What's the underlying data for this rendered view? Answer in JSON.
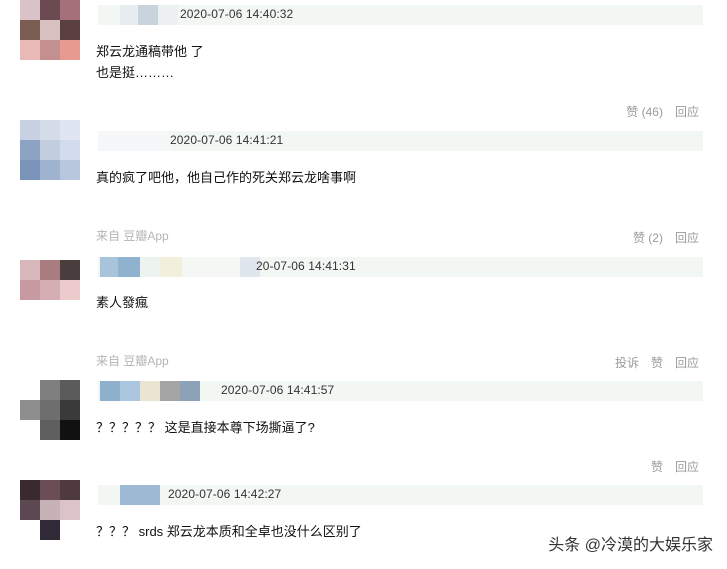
{
  "comments": [
    {
      "timestamp": "2020-07-06 14:40:32",
      "lines": [
        "郑云龙通稿带他 了",
        "也是挺………"
      ],
      "actions": {
        "like": "赞 (46)",
        "reply": "回应"
      }
    },
    {
      "timestamp": "2020-07-06 14:41:21",
      "lines": [
        "真的疯了吧他，他自己作的死关郑云龙啥事啊"
      ],
      "source": "来自 豆瓣App",
      "actions": {
        "like": "赞 (2)",
        "reply": "回应"
      }
    },
    {
      "timestamp": "20-07-06 14:41:31",
      "lines": [
        "素人發瘋"
      ],
      "source": "来自 豆瓣App",
      "actions": {
        "report": "投诉",
        "like": "赞",
        "reply": "回应"
      }
    },
    {
      "timestamp": "2020-07-06 14:41:57",
      "lines": [
        "？？？？？ 这是直接本尊下场撕逼了?"
      ],
      "actions": {
        "like": "赞",
        "reply": "回应"
      }
    },
    {
      "timestamp": "2020-07-06 14:42:27",
      "lines": [
        "？？？ srds 郑云龙本质和全卓也没什么区别了"
      ]
    }
  ],
  "watermark": "头条 @冷漠的大娱乐家",
  "colors": {
    "header_bg": "#f2f7f4",
    "action_text": "#9a9a9a",
    "source_text": "#b4b4b4"
  }
}
